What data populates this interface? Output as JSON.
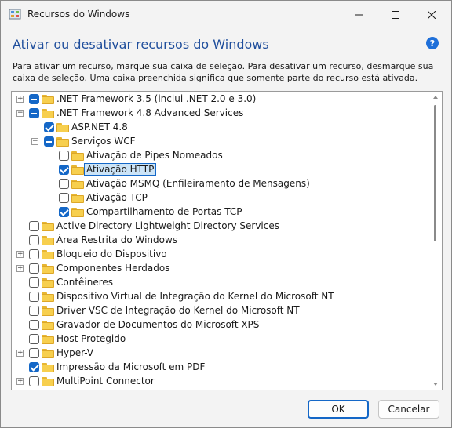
{
  "window": {
    "title": "Recursos do Windows",
    "app_icon": "windows-features-icon",
    "controls": {
      "minimize": "minimize-icon",
      "maximize": "maximize-icon",
      "close": "close-icon"
    }
  },
  "heading": "Ativar ou desativar recursos do Windows",
  "help_label": "?",
  "description": "Para ativar um recurso, marque sua caixa de seleção. Para desativar um recurso, desmarque sua caixa de seleção. Uma caixa preenchida significa que somente parte do recurso está ativada.",
  "tree": [
    {
      "label": ".NET Framework 3.5 (inclui .NET 2.0 e 3.0)",
      "level": 0,
      "expander": "+",
      "state": "partial"
    },
    {
      "label": ".NET Framework 4.8 Advanced Services",
      "level": 0,
      "expander": "-",
      "state": "partial"
    },
    {
      "label": "ASP.NET 4.8",
      "level": 1,
      "expander": "",
      "state": "checked"
    },
    {
      "label": "Serviços WCF",
      "level": 1,
      "expander": "-",
      "state": "partial"
    },
    {
      "label": "Ativação de Pipes Nomeados",
      "level": 2,
      "expander": "",
      "state": "unchecked"
    },
    {
      "label": "Ativação HTTP",
      "level": 2,
      "expander": "",
      "state": "checked",
      "selected": true
    },
    {
      "label": "Ativação MSMQ (Enfileiramento de Mensagens)",
      "level": 2,
      "expander": "",
      "state": "unchecked"
    },
    {
      "label": "Ativação TCP",
      "level": 2,
      "expander": "",
      "state": "unchecked"
    },
    {
      "label": "Compartilhamento de Portas TCP",
      "level": 2,
      "expander": "",
      "state": "checked"
    },
    {
      "label": "Active Directory Lightweight Directory Services",
      "level": 0,
      "expander": "",
      "state": "unchecked"
    },
    {
      "label": "Área Restrita do Windows",
      "level": 0,
      "expander": "",
      "state": "unchecked"
    },
    {
      "label": "Bloqueio do Dispositivo",
      "level": 0,
      "expander": "+",
      "state": "unchecked"
    },
    {
      "label": "Componentes Herdados",
      "level": 0,
      "expander": "+",
      "state": "unchecked"
    },
    {
      "label": "Contêineres",
      "level": 0,
      "expander": "",
      "state": "unchecked"
    },
    {
      "label": "Dispositivo Virtual de Integração do Kernel do Microsoft NT",
      "level": 0,
      "expander": "",
      "state": "unchecked"
    },
    {
      "label": "Driver VSC de Integração do Kernel do Microsoft NT",
      "level": 0,
      "expander": "",
      "state": "unchecked"
    },
    {
      "label": "Gravador de Documentos do Microsoft XPS",
      "level": 0,
      "expander": "",
      "state": "unchecked"
    },
    {
      "label": "Host Protegido",
      "level": 0,
      "expander": "",
      "state": "unchecked"
    },
    {
      "label": "Hyper-V",
      "level": 0,
      "expander": "+",
      "state": "unchecked"
    },
    {
      "label": "Impressão da Microsoft em PDF",
      "level": 0,
      "expander": "",
      "state": "checked"
    },
    {
      "label": "MultiPoint Connector",
      "level": 0,
      "expander": "+",
      "state": "unchecked"
    }
  ],
  "buttons": {
    "ok": "OK",
    "cancel": "Cancelar"
  },
  "colors": {
    "accent": "#1467c7",
    "heading": "#1f4e9c",
    "folder": "#f7cf4e"
  }
}
